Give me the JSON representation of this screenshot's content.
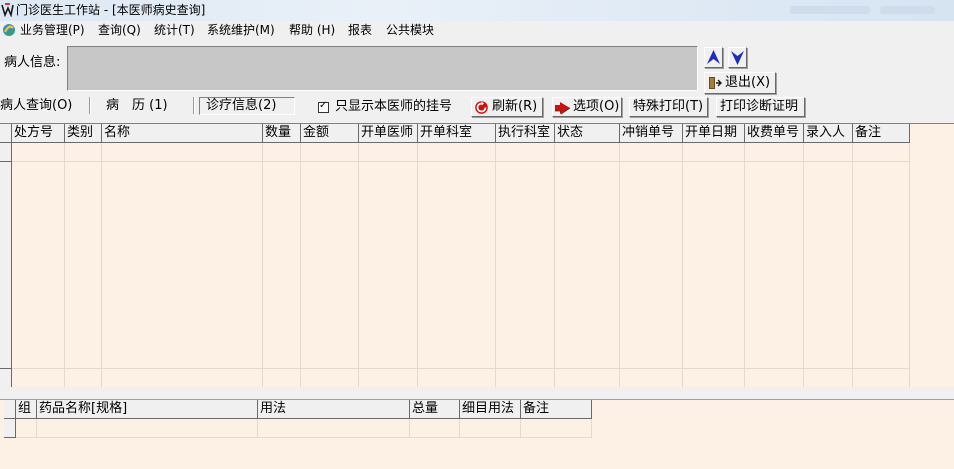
{
  "window": {
    "title": "门诊医生工作站 - [本医师病史查询]"
  },
  "menu": [
    "业务管理(P)",
    "查询(Q)",
    "统计(T)",
    "系统维护(M)",
    "帮助 (H)",
    "报表",
    "公共模块"
  ],
  "patient": {
    "label": "病人信息:",
    "value": ""
  },
  "buttons": {
    "up": "▲",
    "down": "▼",
    "exit": "退出(X)"
  },
  "tabs": [
    "病人查询(O)",
    "病　历 (1)",
    "诊疗信息(2)"
  ],
  "filter": {
    "check_mark": "✓",
    "label": "只显示本医师的挂号"
  },
  "toolbar": {
    "refresh": "刷新(R)",
    "options": "选项(O)",
    "special_print": "特殊打印(T)",
    "print_cert": "打印诊断证明"
  },
  "grid_main": {
    "columns": [
      "处方号",
      "类别",
      "名称",
      "数量",
      "金额",
      "开单医师",
      "开单科室",
      "执行科室",
      "状态",
      "冲销单号",
      "开单日期",
      "收费单号",
      "录入人",
      "备注"
    ]
  },
  "grid_detail": {
    "columns": [
      "组",
      "药品名称[规格]",
      "用法",
      "总量",
      "细目用法",
      "备注"
    ]
  },
  "colors": {
    "grid_bg": "#fdf0e4",
    "info_box": "#c7c7c7",
    "arrow_blue": "#1e2dbe",
    "refresh_red": "#cc1111"
  }
}
